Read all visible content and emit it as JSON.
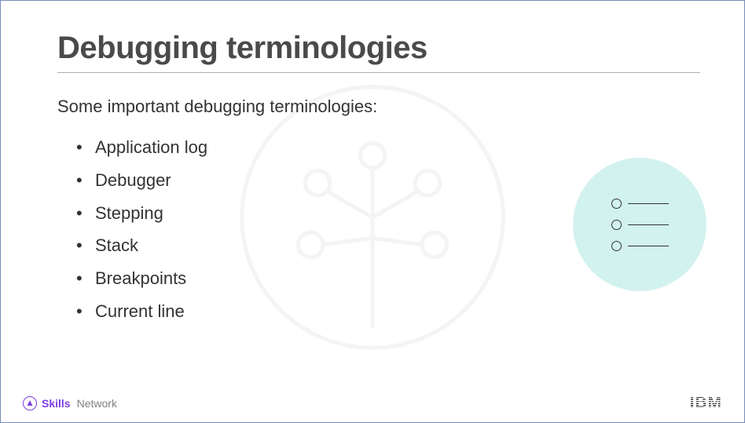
{
  "title": "Debugging terminologies",
  "intro": "Some important debugging terminologies:",
  "bullets": [
    "Application log",
    "Debugger",
    "Stepping",
    "Stack",
    "Breakpoints",
    "Current line"
  ],
  "footer": {
    "skills_word": "Skills",
    "network_word": "Network",
    "ibm": "IBM"
  }
}
